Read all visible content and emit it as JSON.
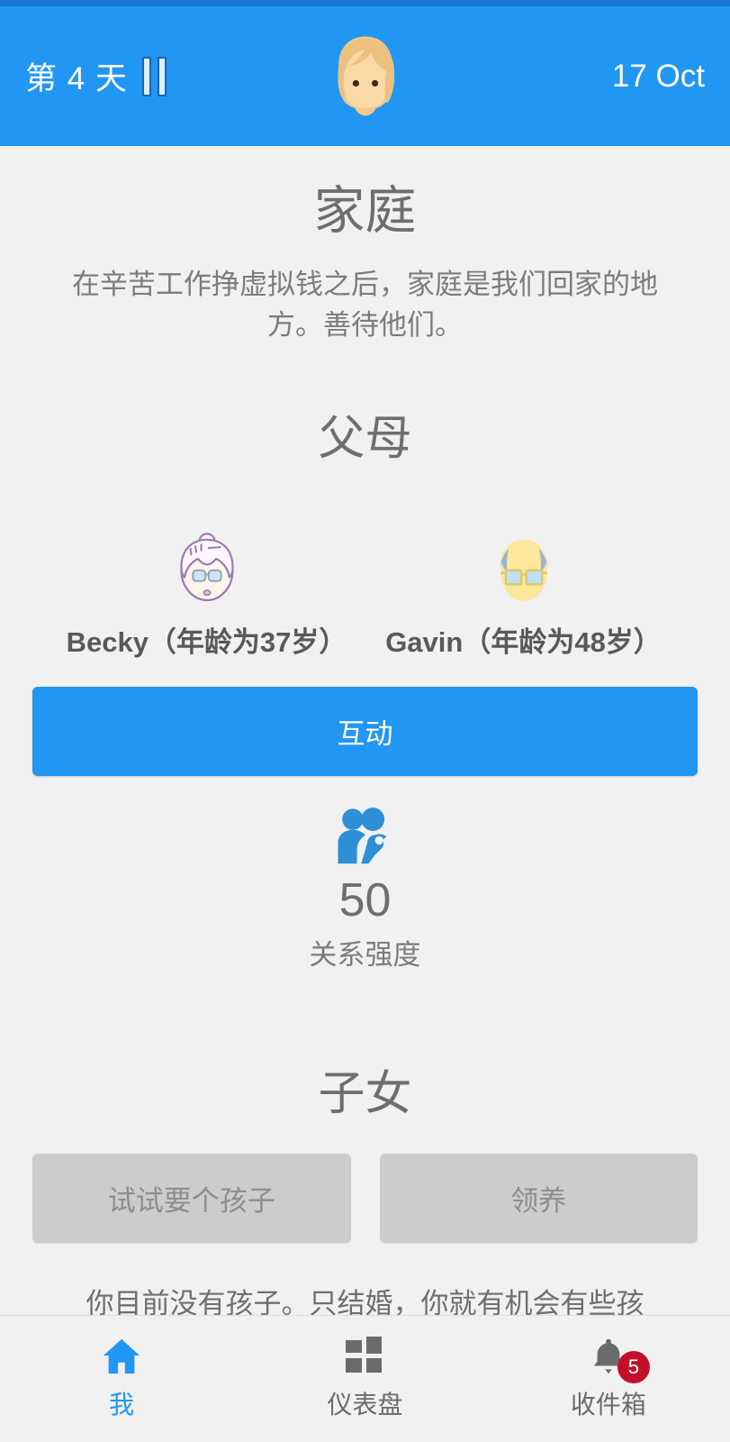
{
  "header": {
    "day_label": "第 4 天",
    "pause_icon": "pause-icon",
    "avatar_icon": "blonde-woman-avatar",
    "date": "17 Oct",
    "background_color": "#2196f3",
    "status_strip_color": "#1976d2"
  },
  "page": {
    "title": "家庭",
    "subtitle": "在辛苦工作挣虚拟钱之后，家庭是我们回家的地方。善待他们。"
  },
  "parents": {
    "section_title": "父母",
    "members": [
      {
        "name_label": "Becky（年龄为37岁）",
        "avatar_icon": "older-woman-face"
      },
      {
        "name_label": "Gavin（年龄为48岁）",
        "avatar_icon": "older-man-face"
      }
    ],
    "interact_button": "互动",
    "stat": {
      "icon": "couple-relationship-icon",
      "value": "50",
      "label": "关系强度",
      "color": "#2196f3"
    }
  },
  "children": {
    "section_title": "子女",
    "buttons": [
      {
        "label": "试试要个孩子",
        "disabled": true
      },
      {
        "label": "领养",
        "disabled": true
      }
    ],
    "note": "你目前没有孩子。只结婚，你就有机会有些孩"
  },
  "bottom_nav": {
    "items": [
      {
        "label": "我",
        "icon": "home-icon",
        "active": true,
        "badge": ""
      },
      {
        "label": "仪表盘",
        "icon": "dashboard-grid-icon",
        "active": false,
        "badge": ""
      },
      {
        "label": "收件箱",
        "icon": "bell-icon",
        "active": false,
        "badge": "5"
      }
    ],
    "badge_color": "#c2102b",
    "active_color": "#2196f3"
  }
}
